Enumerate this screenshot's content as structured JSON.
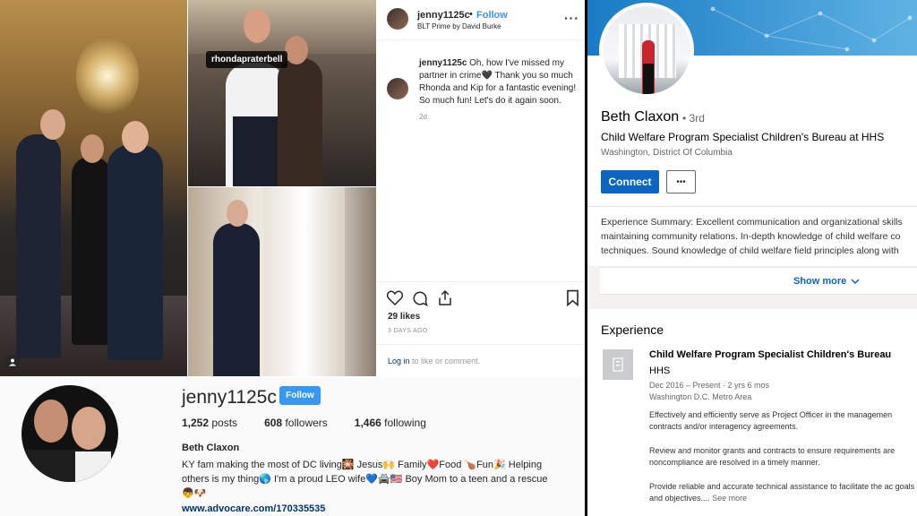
{
  "post": {
    "username": "jenny1125c",
    "follow_label": "Follow",
    "location": "BLT Prime by David Burke",
    "more_icon": "more-horizontal-icon",
    "photo_tag": "rhondapraterbell",
    "caption": {
      "username": "jenny1125c",
      "text": "Oh, how I've missed my partner in crime🖤 Thank you so much Rhonda and Kip for a fantastic evening! So much fun! Let's do it again soon."
    },
    "caption_age": "2d",
    "likes": "29 likes",
    "timestamp": "3 DAYS AGO",
    "login_link": "Log in",
    "login_rest": "to like or comment."
  },
  "profile": {
    "username": "jenny1125c",
    "follow_label": "Follow",
    "posts_count": "1,252",
    "posts_label": "posts",
    "followers_count": "608",
    "followers_label": "followers",
    "following_count": "1,466",
    "following_label": "following",
    "full_name": "Beth Claxon",
    "bio": "KY fam making the most of DC living🎇 Jesus🙌 Family❤️Food 🍗Fun🎉 Helping others is my thing🌎 I'm a proud LEO wife💙🚔🇺🇸 Boy Mom to a teen and a rescue👦🐶",
    "link": "www.advocare.com/170335535"
  },
  "linkedin": {
    "name": "Beth Claxon",
    "degree": "3rd",
    "headline": "Child Welfare Program Specialist Children's Bureau at HHS",
    "location": "Washington, District Of Columbia",
    "connect_label": "Connect",
    "more_label": "•••",
    "summary": "Experience Summary: Excellent communication and organizational skills maintaining community relations. In-depth knowledge of child welfare co techniques. Sound knowledge of child welfare field principles along with",
    "show_more_label": "Show more",
    "experience_heading": "Experience",
    "job": {
      "title": "Child Welfare Program Specialist Children's Bureau",
      "company": "HHS",
      "dates": "Dec 2016 – Present · 2 yrs 6 mos",
      "location": "Washington D.C. Metro Area",
      "desc1": "Effectively and efficiently serve as Project Officer in the managemen contracts and/or interagency agreements.",
      "desc2": "Review and monitor grants and contracts to ensure requirements are noncompliance are resolved in a timely manner.",
      "desc3": "Provide reliable and accurate technical assistance to facilitate the ac goals and objectives....",
      "see_more": "See more"
    }
  }
}
